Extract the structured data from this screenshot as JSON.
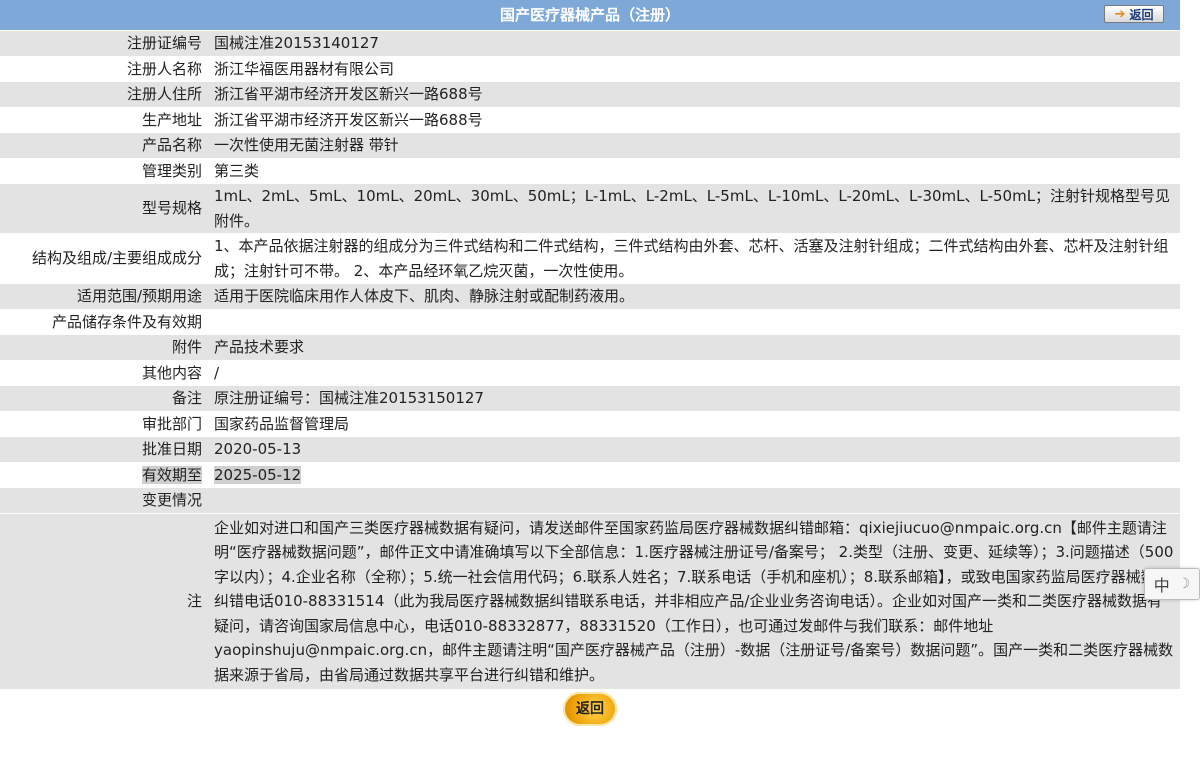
{
  "header": {
    "title": "国产医疗器械产品（注册）",
    "back_label": "返回"
  },
  "fields": [
    {
      "label": "注册证编号",
      "value": "国械注准20153140127"
    },
    {
      "label": "注册人名称",
      "value": "浙江华福医用器材有限公司"
    },
    {
      "label": "注册人住所",
      "value": "浙江省平湖市经济开发区新兴一路688号"
    },
    {
      "label": "生产地址",
      "value": "浙江省平湖市经济开发区新兴一路688号"
    },
    {
      "label": "产品名称",
      "value": "一次性使用无菌注射器 带针"
    },
    {
      "label": "管理类别",
      "value": "第三类"
    },
    {
      "label": "型号规格",
      "value": "1mL、2mL、5mL、10mL、20mL、30mL、50mL；L-1mL、L-2mL、L-5mL、L-10mL、L-20mL、L-30mL、L-50mL；注射针规格型号见附件。"
    },
    {
      "label": "结构及组成/主要组成成分",
      "value": "1、本产品依据注射器的组成分为三件式结构和二件式结构，三件式结构由外套、芯杆、活塞及注射针组成；二件式结构由外套、芯杆及注射针组成；注射针可不带。 2、本产品经环氧乙烷灭菌，一次性使用。"
    },
    {
      "label": "适用范围/预期用途",
      "value": "适用于医院临床用作人体皮下、肌肉、静脉注射或配制药液用。"
    },
    {
      "label": "产品储存条件及有效期",
      "value": ""
    },
    {
      "label": "附件",
      "value": "产品技术要求"
    },
    {
      "label": "其他内容",
      "value": "/"
    },
    {
      "label": "备注",
      "value": "原注册证编号：国械注准20153150127"
    },
    {
      "label": "审批部门",
      "value": "国家药品监督管理局"
    },
    {
      "label": "批准日期",
      "value": "2020-05-13"
    },
    {
      "label": "有效期至",
      "value": "2025-05-12"
    },
    {
      "label": "变更情况",
      "value": ""
    }
  ],
  "note": {
    "label": "注",
    "text": "企业如对进口和国产三类医疗器械数据有疑问，请发送邮件至国家药监局医疗器械数据纠错邮箱：qixiejiucuo@nmpaic.org.cn【邮件主题请注明“医疗器械数据问题”，邮件正文中请准确填写以下全部信息：1.医疗器械注册证号/备案号； 2.类型（注册、变更、延续等）；3.问题描述（500字以内）；4.企业名称（全称）；5.统一社会信用代码；6.联系人姓名；7.联系电话（手机和座机）；8.联系邮箱】，或致电国家药监局医疗器械数据纠错电话010-88331514（此为我局医疗器械数据纠错联系电话，并非相应产品/企业业务咨询电话）。企业如对国产一类和二类医疗器械数据有疑问，请咨询国家局信息中心，电话010-88332877，88331520（工作日），也可通过发邮件与我们联系：邮件地址yaopinshuju@nmpaic.org.cn，邮件主题请注明“国产医疗器械产品（注册）-数据（注册证号/备案号）数据问题”。国产一类和二类医疗器械数据来源于省局，由省局通过数据共享平台进行纠错和维护。"
  },
  "footer": {
    "back_label": "返回"
  },
  "ime": {
    "mode_label": "中",
    "moon_symbol": "☽"
  },
  "colors": {
    "title_bar": "#7ea8d8",
    "row_shaded": "#e3e3e3",
    "back_button_orange": "#f0a30a"
  }
}
